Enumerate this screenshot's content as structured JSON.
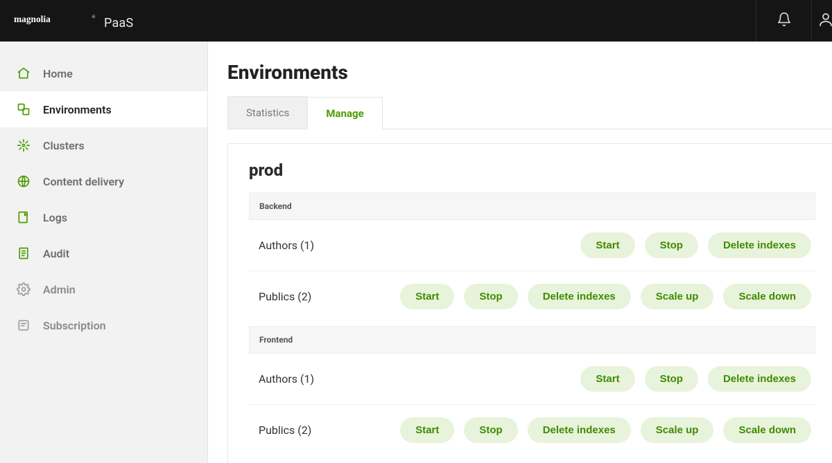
{
  "brand": {
    "name": "magnolia",
    "product": "PaaS"
  },
  "sidebar": {
    "items": [
      {
        "label": "Home"
      },
      {
        "label": "Environments"
      },
      {
        "label": "Clusters"
      },
      {
        "label": "Content delivery"
      },
      {
        "label": "Logs"
      },
      {
        "label": "Audit"
      },
      {
        "label": "Admin"
      },
      {
        "label": "Subscription"
      }
    ],
    "activeIndex": 1
  },
  "page": {
    "title": "Environments"
  },
  "tabs": {
    "items": [
      {
        "label": "Statistics"
      },
      {
        "label": "Manage"
      }
    ],
    "activeIndex": 1
  },
  "environment": {
    "name": "prod",
    "sections": [
      {
        "title": "Backend",
        "rows": [
          {
            "label": "Authors (1)",
            "actions": [
              "Start",
              "Stop",
              "Delete indexes"
            ]
          },
          {
            "label": "Publics (2)",
            "actions": [
              "Start",
              "Stop",
              "Delete indexes",
              "Scale up",
              "Scale down"
            ]
          }
        ]
      },
      {
        "title": "Frontend",
        "rows": [
          {
            "label": "Authors (1)",
            "actions": [
              "Start",
              "Stop",
              "Delete indexes"
            ]
          },
          {
            "label": "Publics (2)",
            "actions": [
              "Start",
              "Stop",
              "Delete indexes",
              "Scale up",
              "Scale down"
            ]
          }
        ]
      }
    ]
  }
}
